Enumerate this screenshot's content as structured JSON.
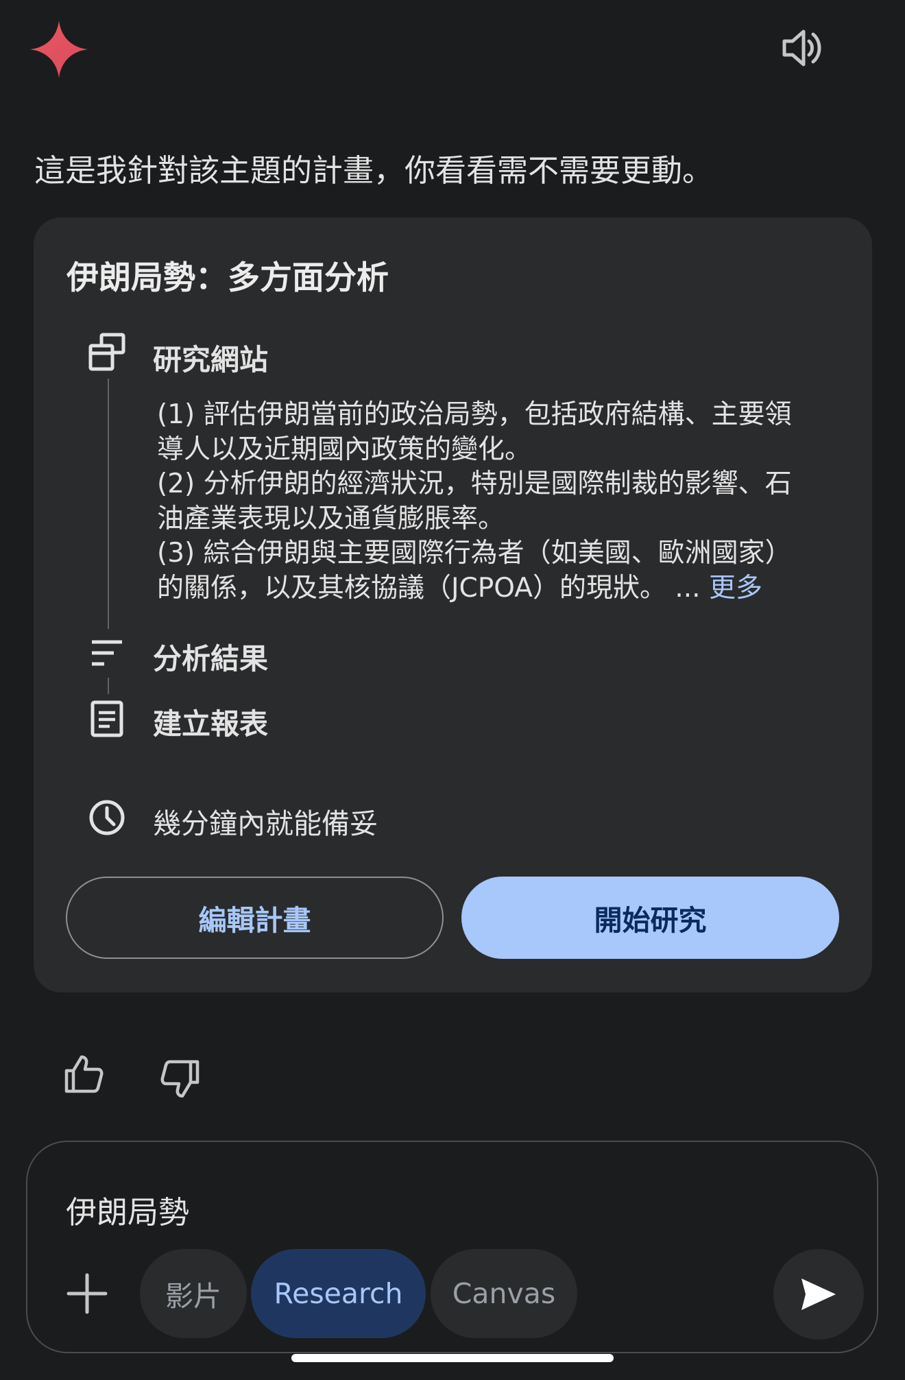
{
  "intro": "這是我針對該主題的計畫，你看看需不需要更動。",
  "plan_card": {
    "title": "伊朗局勢：多方面分析",
    "steps": [
      {
        "icon": "browse-windows-icon",
        "label": "研究網站"
      },
      {
        "icon": "sort-lines-icon",
        "label": "分析結果"
      },
      {
        "icon": "document-icon",
        "label": "建立報表"
      }
    ],
    "plan_lines": [
      "(1) 評估伊朗當前的政治局勢，包括政府結構、主要領",
      "導人以及近期國內政策的變化。",
      "(2) 分析伊朗的經濟狀況，特別是國際制裁的影響、石",
      "油產業表現以及通貨膨脹率。",
      "(3) 綜合伊朗與主要國際行為者（如美國、歐洲國家）",
      "的關係，以及其核協議（JCPOA）的現狀。 ..."
    ],
    "more_link": "更多",
    "eta_icon": "clock-icon",
    "eta": "幾分鐘內就能備妥",
    "edit_button": "編輯計畫",
    "start_button": "開始研究"
  },
  "feedback": {
    "like_icon": "thumbs-up-icon",
    "dislike_icon": "thumbs-down-icon"
  },
  "composer": {
    "query": "伊朗局勢",
    "add_icon": "plus-icon",
    "chips": [
      "影片",
      "Research",
      "Canvas"
    ],
    "send_icon": "send-icon"
  },
  "colors": {
    "background": "#1b1c1e",
    "card": "#2a2b2d",
    "accent": "#a8c7fa",
    "primary_button_text": "#0a2a5e",
    "research_chip": "#1f3760"
  }
}
